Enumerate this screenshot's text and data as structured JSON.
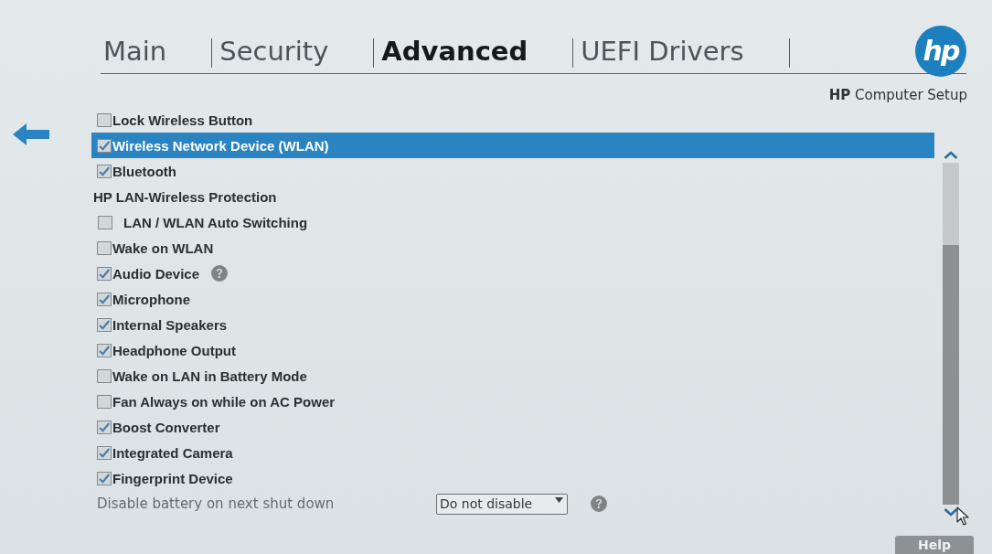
{
  "header": {
    "tabs": [
      {
        "label": "Main",
        "selected": false
      },
      {
        "label": "Security",
        "selected": false
      },
      {
        "label": "Advanced",
        "selected": true
      },
      {
        "label": "UEFI Drivers",
        "selected": false
      }
    ],
    "logo": "hp",
    "subtitle": "**HP** Computer Setup"
  },
  "settings": [
    {
      "kind": "checkbox",
      "label": "Lock Wireless Button",
      "checked": false,
      "selected": false,
      "help": false
    },
    {
      "kind": "checkbox",
      "label": "Wireless Network Device (WLAN)",
      "checked": true,
      "selected": true,
      "help": false
    },
    {
      "kind": "checkbox",
      "label": "Bluetooth",
      "checked": true,
      "selected": false,
      "help": false
    },
    {
      "kind": "group",
      "label": "HP LAN-Wireless Protection",
      "selected": false,
      "children": [
        {
          "kind": "checkbox",
          "label": "LAN / WLAN Auto Switching",
          "checked": false,
          "selected": false,
          "help": false
        }
      ]
    },
    {
      "kind": "checkbox",
      "label": "Wake on WLAN",
      "checked": false,
      "selected": false,
      "help": false
    },
    {
      "kind": "checkbox",
      "label": "Audio Device",
      "checked": true,
      "selected": false,
      "help": true
    },
    {
      "kind": "checkbox",
      "label": "Microphone",
      "checked": true,
      "selected": false,
      "help": false
    },
    {
      "kind": "checkbox",
      "label": "Internal Speakers",
      "checked": true,
      "selected": false,
      "help": false
    },
    {
      "kind": "checkbox",
      "label": "Headphone Output",
      "checked": true,
      "selected": false,
      "help": false
    },
    {
      "kind": "checkbox",
      "label": "Wake on LAN in Battery Mode",
      "checked": false,
      "selected": false,
      "help": false
    },
    {
      "kind": "checkbox",
      "label": "Fan Always on while on AC Power",
      "checked": false,
      "selected": false,
      "help": false
    },
    {
      "kind": "checkbox",
      "label": "Boost Converter",
      "checked": true,
      "selected": false,
      "help": false
    },
    {
      "kind": "checkbox",
      "label": "Integrated Camera",
      "checked": true,
      "selected": false,
      "help": false
    },
    {
      "kind": "checkbox",
      "label": "Fingerprint Device",
      "checked": true,
      "selected": false,
      "help": false
    },
    {
      "kind": "dropdown",
      "label": "Disable battery on next shut down",
      "value": "Do not disable",
      "selected": false,
      "help": true
    }
  ],
  "help_button": "Help"
}
